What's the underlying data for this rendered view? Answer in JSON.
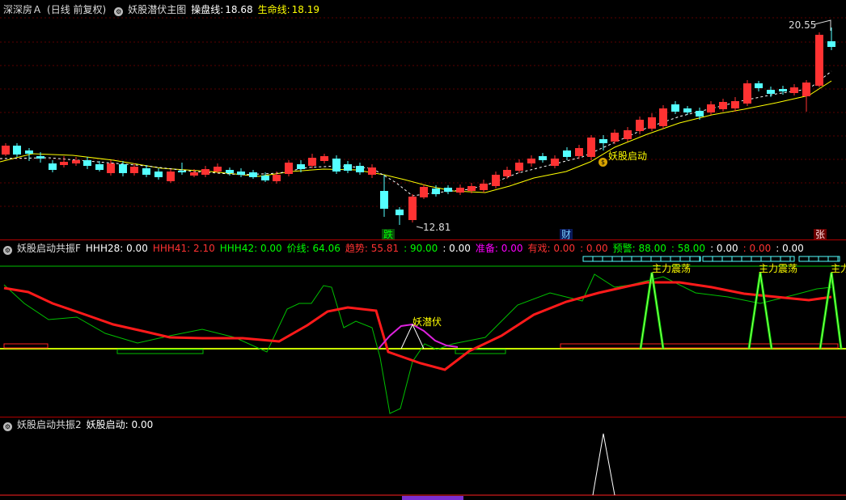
{
  "main": {
    "stock_name": "深深房Ａ",
    "period": "(日线 前复权)",
    "indicator": "妖股潜伏主图",
    "pan_label": "操盘线:",
    "pan_value": "18.68",
    "life_label": "生命线:",
    "life_value": "18.19",
    "high_price": "20.55",
    "low_price": "12.81",
    "signal": "妖股启动",
    "badge_die": "跌",
    "badge_cai": "财",
    "badge_zhang": "张",
    "colors": {
      "up": "#ff3232",
      "down": "#54ffff",
      "ma": "#ffff00",
      "pan": "#ffffff"
    }
  },
  "panel2": {
    "title": "妖股启动共振F",
    "fields": [
      {
        "text": "HHH28: 0.00",
        "color": "#ffffff"
      },
      {
        "text": "HHH41: 2.10",
        "color": "#ff3232"
      },
      {
        "text": "HHH42: 0.00",
        "color": "#00ff00"
      },
      {
        "text": "价线: 64.06",
        "color": "#00ff00"
      },
      {
        "text": "趋势: 55.81",
        "color": "#ff3232"
      },
      {
        "text": ": 90.00",
        "color": "#00ff00"
      },
      {
        "text": ": 0.00",
        "color": "#ffffff"
      },
      {
        "text": "准备: 0.00",
        "color": "#ff00ff"
      },
      {
        "text": "有戏: 0.00",
        "color": "#ff3232"
      },
      {
        "text": ": 0.00",
        "color": "#ff3232"
      },
      {
        "text": "预警: 88.00",
        "color": "#00ff00"
      },
      {
        "text": ": 58.00",
        "color": "#00ff00"
      },
      {
        "text": ": 0.00",
        "color": "#ffffff"
      },
      {
        "text": ": 0.00",
        "color": "#ff3232"
      },
      {
        "text": ": 0.00",
        "color": "#ffffff"
      }
    ],
    "label_yao": "妖潜伏",
    "label_zhuli_1": "主力震荡",
    "label_zhuli_2": "主力震荡",
    "label_zhuli_3": "主力"
  },
  "panel3": {
    "title": "妖股启动共振2",
    "field": "妖股启动: 0.00"
  }
}
